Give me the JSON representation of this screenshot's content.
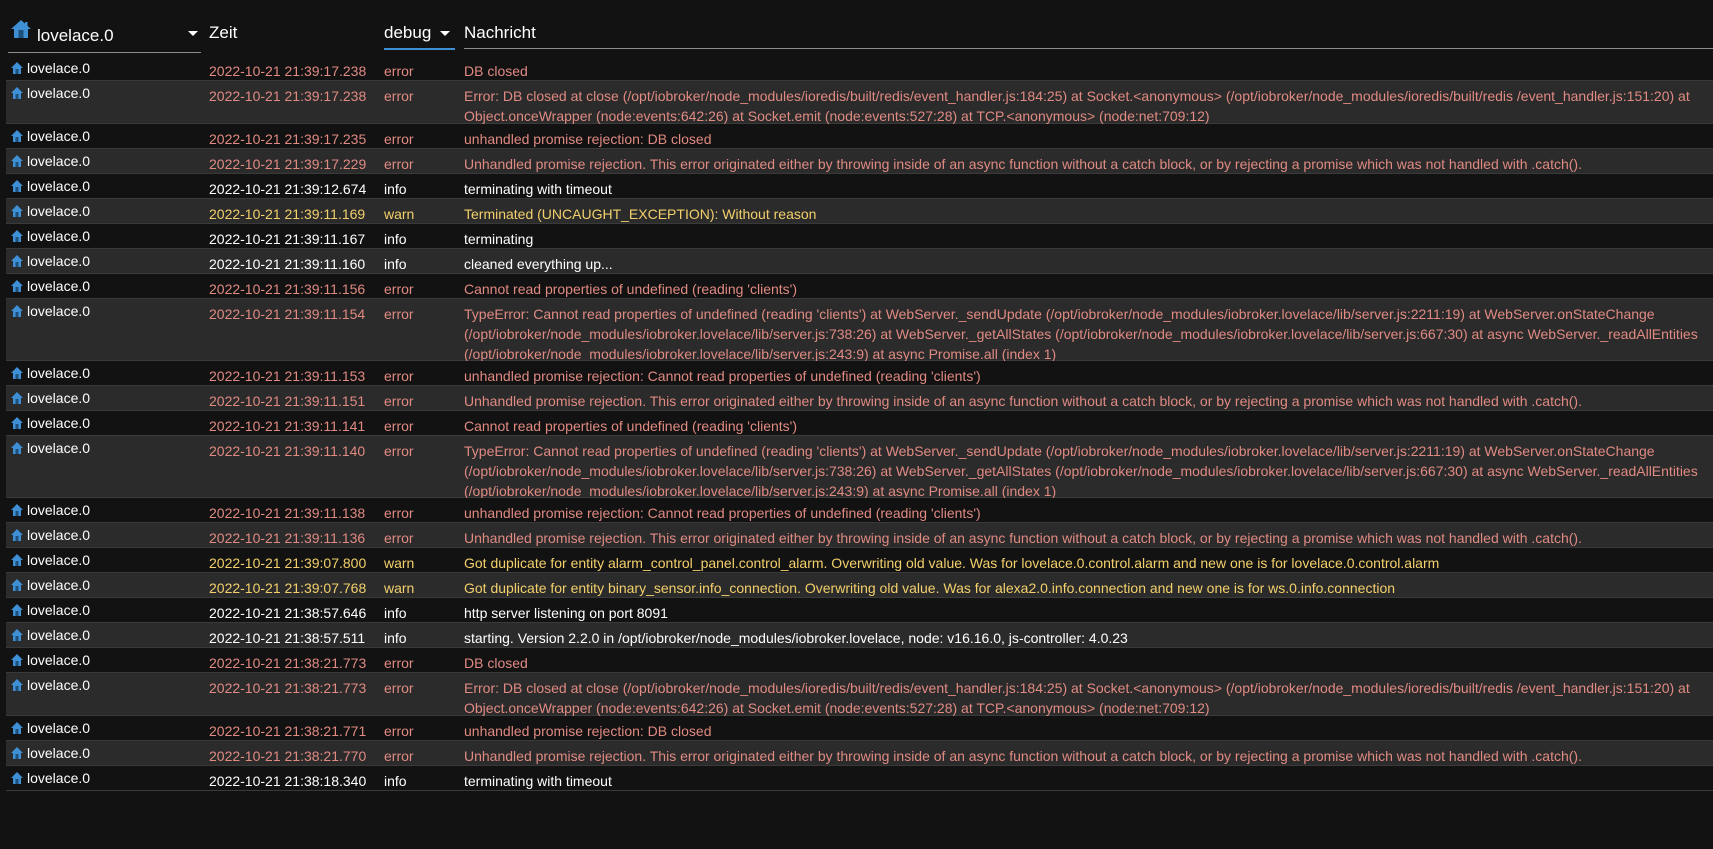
{
  "header": {
    "source_filter": "lovelace.0",
    "time_label": "Zeit",
    "level_filter": "debug",
    "message_label": "Nachricht"
  },
  "colors": {
    "error": "#e08a82",
    "warn": "#f3d06b",
    "info": "#ffffff",
    "accent": "#3f8fd4"
  },
  "icons": {
    "source": "home-icon"
  },
  "rows": [
    {
      "source": "lovelace.0",
      "time": "2022-10-21 21:39:17.238",
      "level": "error",
      "message": "DB closed"
    },
    {
      "source": "lovelace.0",
      "time": "2022-10-21 21:39:17.238",
      "level": "error",
      "message": "Error: DB closed at close (/opt/iobroker/node_modules/ioredis/built/redis/event_handler.js:184:25) at Socket.<anonymous> (/opt/iobroker/node_modules/ioredis/built/redis /event_handler.js:151:20) at Object.onceWrapper (node:events:642:26) at Socket.emit (node:events:527:28) at TCP.<anonymous> (node:net:709:12)"
    },
    {
      "source": "lovelace.0",
      "time": "2022-10-21 21:39:17.235",
      "level": "error",
      "message": "unhandled promise rejection: DB closed"
    },
    {
      "source": "lovelace.0",
      "time": "2022-10-21 21:39:17.229",
      "level": "error",
      "message": "Unhandled promise rejection. This error originated either by throwing inside of an async function without a catch block, or by rejecting a promise which was not handled with .catch()."
    },
    {
      "source": "lovelace.0",
      "time": "2022-10-21 21:39:12.674",
      "level": "info",
      "message": "terminating with timeout"
    },
    {
      "source": "lovelace.0",
      "time": "2022-10-21 21:39:11.169",
      "level": "warn",
      "message": "Terminated (UNCAUGHT_EXCEPTION): Without reason"
    },
    {
      "source": "lovelace.0",
      "time": "2022-10-21 21:39:11.167",
      "level": "info",
      "message": "terminating"
    },
    {
      "source": "lovelace.0",
      "time": "2022-10-21 21:39:11.160",
      "level": "info",
      "message": "cleaned everything up..."
    },
    {
      "source": "lovelace.0",
      "time": "2022-10-21 21:39:11.156",
      "level": "error",
      "message": "Cannot read properties of undefined (reading 'clients')"
    },
    {
      "source": "lovelace.0",
      "time": "2022-10-21 21:39:11.154",
      "level": "error",
      "message": "TypeError: Cannot read properties of undefined (reading 'clients') at WebServer._sendUpdate (/opt/iobroker/node_modules/iobroker.lovelace/lib/server.js:2211:19) at WebServer.onStateChange (/opt/iobroker/node_modules/iobroker.lovelace/lib/server.js:738:26) at WebServer._getAllStates (/opt/iobroker/node_modules/iobroker.lovelace/lib/server.js:667:30) at async WebServer._readAllEntities (/opt/iobroker/node_modules/iobroker.lovelace/lib/server.js:243:9) at async Promise.all (index 1)"
    },
    {
      "source": "lovelace.0",
      "time": "2022-10-21 21:39:11.153",
      "level": "error",
      "message": "unhandled promise rejection: Cannot read properties of undefined (reading 'clients')"
    },
    {
      "source": "lovelace.0",
      "time": "2022-10-21 21:39:11.151",
      "level": "error",
      "message": "Unhandled promise rejection. This error originated either by throwing inside of an async function without a catch block, or by rejecting a promise which was not handled with .catch()."
    },
    {
      "source": "lovelace.0",
      "time": "2022-10-21 21:39:11.141",
      "level": "error",
      "message": "Cannot read properties of undefined (reading 'clients')"
    },
    {
      "source": "lovelace.0",
      "time": "2022-10-21 21:39:11.140",
      "level": "error",
      "message": "TypeError: Cannot read properties of undefined (reading 'clients') at WebServer._sendUpdate (/opt/iobroker/node_modules/iobroker.lovelace/lib/server.js:2211:19) at WebServer.onStateChange (/opt/iobroker/node_modules/iobroker.lovelace/lib/server.js:738:26) at WebServer._getAllStates (/opt/iobroker/node_modules/iobroker.lovelace/lib/server.js:667:30) at async WebServer._readAllEntities (/opt/iobroker/node_modules/iobroker.lovelace/lib/server.js:243:9) at async Promise.all (index 1)"
    },
    {
      "source": "lovelace.0",
      "time": "2022-10-21 21:39:11.138",
      "level": "error",
      "message": "unhandled promise rejection: Cannot read properties of undefined (reading 'clients')"
    },
    {
      "source": "lovelace.0",
      "time": "2022-10-21 21:39:11.136",
      "level": "error",
      "message": "Unhandled promise rejection. This error originated either by throwing inside of an async function without a catch block, or by rejecting a promise which was not handled with .catch()."
    },
    {
      "source": "lovelace.0",
      "time": "2022-10-21 21:39:07.800",
      "level": "warn",
      "message": "Got duplicate for entity alarm_control_panel.control_alarm. Overwriting old value. Was for lovelace.0.control.alarm and new one is for lovelace.0.control.alarm"
    },
    {
      "source": "lovelace.0",
      "time": "2022-10-21 21:39:07.768",
      "level": "warn",
      "message": "Got duplicate for entity binary_sensor.info_connection. Overwriting old value. Was for alexa2.0.info.connection and new one is for ws.0.info.connection"
    },
    {
      "source": "lovelace.0",
      "time": "2022-10-21 21:38:57.646",
      "level": "info",
      "message": "http server listening on port 8091"
    },
    {
      "source": "lovelace.0",
      "time": "2022-10-21 21:38:57.511",
      "level": "info",
      "message": "starting. Version 2.2.0 in /opt/iobroker/node_modules/iobroker.lovelace, node: v16.16.0, js-controller: 4.0.23"
    },
    {
      "source": "lovelace.0",
      "time": "2022-10-21 21:38:21.773",
      "level": "error",
      "message": "DB closed"
    },
    {
      "source": "lovelace.0",
      "time": "2022-10-21 21:38:21.773",
      "level": "error",
      "message": "Error: DB closed at close (/opt/iobroker/node_modules/ioredis/built/redis/event_handler.js:184:25) at Socket.<anonymous> (/opt/iobroker/node_modules/ioredis/built/redis /event_handler.js:151:20) at Object.onceWrapper (node:events:642:26) at Socket.emit (node:events:527:28) at TCP.<anonymous> (node:net:709:12)"
    },
    {
      "source": "lovelace.0",
      "time": "2022-10-21 21:38:21.771",
      "level": "error",
      "message": "unhandled promise rejection: DB closed"
    },
    {
      "source": "lovelace.0",
      "time": "2022-10-21 21:38:21.770",
      "level": "error",
      "message": "Unhandled promise rejection. This error originated either by throwing inside of an async function without a catch block, or by rejecting a promise which was not handled with .catch()."
    },
    {
      "source": "lovelace.0",
      "time": "2022-10-21 21:38:18.340",
      "level": "info",
      "message": "terminating with timeout"
    }
  ]
}
